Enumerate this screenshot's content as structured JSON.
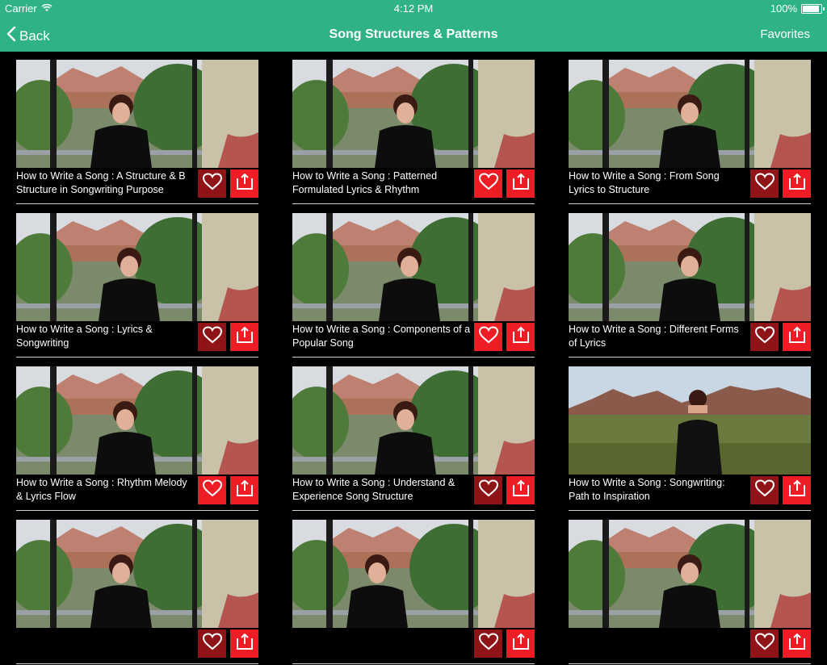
{
  "status_bar": {
    "carrier": "Carrier",
    "time": "4:12 PM",
    "battery": "100%",
    "battery_level": 1.0
  },
  "nav": {
    "back_label": "Back",
    "title": "Song Structures & Patterns",
    "favorites_label": "Favorites",
    "color": "#2fb386"
  },
  "colors": {
    "fav_active": "#ee1c24",
    "fav_inactive": "#8e1418",
    "share": "#ee1c24"
  },
  "icons": {
    "favorite": "heart-icon",
    "share": "share-icon",
    "back": "chevron-left-icon"
  },
  "videos": [
    {
      "title": "How to Write a Song : A Structure & B Structure in Songwriting Purpose",
      "favorited": false
    },
    {
      "title": "How to Write a Song : Patterned Formulated Lyrics & Rhythm",
      "favorited": true
    },
    {
      "title": "How to Write a Song : From Song Lyrics to Structure",
      "favorited": false
    },
    {
      "title": "How to Write a Song : Lyrics & Songwriting",
      "favorited": false
    },
    {
      "title": "How to Write a Song : Components of a Popular Song",
      "favorited": true
    },
    {
      "title": "How to Write a Song : Different Forms of Lyrics",
      "favorited": false
    },
    {
      "title": "How to Write a Song : Rhythm Melody & Lyrics Flow",
      "favorited": true
    },
    {
      "title": "How to Write a Song : Understand & Experience Song Structure",
      "favorited": false
    },
    {
      "title": "How to Write a Song : Songwriting: Path to Inspiration",
      "favorited": false
    },
    {
      "title": "",
      "favorited": false
    },
    {
      "title": "",
      "favorited": false
    },
    {
      "title": "",
      "favorited": false
    }
  ]
}
